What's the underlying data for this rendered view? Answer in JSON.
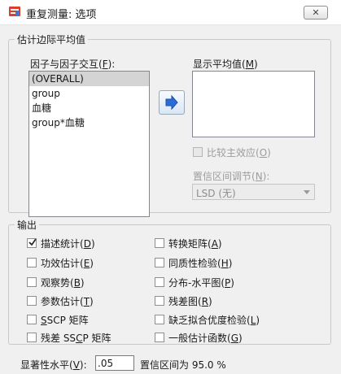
{
  "window": {
    "title": "重复测量: 选项",
    "close_glyph": "✕"
  },
  "estimated_marginal_means": {
    "group_title": "估计边际平均值",
    "factors_label": "因子与因子交互(F):",
    "factors": [
      {
        "label": "(OVERALL)",
        "selected": true
      },
      {
        "label": "group",
        "selected": false
      },
      {
        "label": "血糖",
        "selected": false
      },
      {
        "label": "group*血糖",
        "selected": false
      }
    ],
    "display_means_label": "显示平均值(M)",
    "display_means": [],
    "compare_main_effects": {
      "label": "比较主效应(O)",
      "checked": false,
      "enabled": false
    },
    "ci_adjustment_label": "置信区间调节(N):",
    "ci_adjustment_value": "LSD (无)"
  },
  "output": {
    "group_title": "输出",
    "left": [
      {
        "label": "描述统计(D)",
        "checked": true
      },
      {
        "label": "功效估计(E)",
        "checked": false
      },
      {
        "label": "观察势(B)",
        "checked": false
      },
      {
        "label": "参数估计(T)",
        "checked": false
      },
      {
        "label": "SSCP 矩阵",
        "checked": false
      },
      {
        "label": "残差 SSCP 矩阵",
        "checked": false
      }
    ],
    "right": [
      {
        "label": "转换矩阵(A)",
        "checked": false
      },
      {
        "label": "同质性检验(H)",
        "checked": false
      },
      {
        "label": "分布-水平图(P)",
        "checked": false
      },
      {
        "label": "残差图(R)",
        "checked": false
      },
      {
        "label": "缺乏拟合优度检验(L)",
        "checked": false
      },
      {
        "label": "一般估计函数(G)",
        "checked": false
      }
    ]
  },
  "significance": {
    "label": "显著性水平(V):",
    "value": ".05",
    "ci_text": "置信区间为 95.0 %"
  },
  "colors": {
    "accent": "#2b6bd6",
    "selection": "#d4d4d4"
  }
}
